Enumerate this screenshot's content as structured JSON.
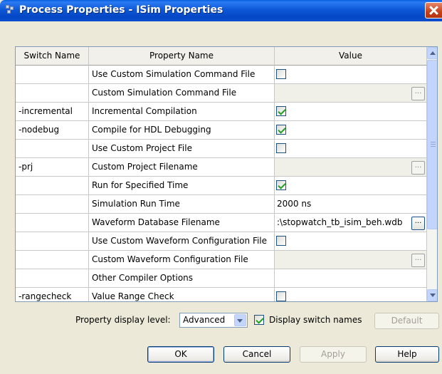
{
  "window": {
    "title": "Process Properties - ISim Properties"
  },
  "table": {
    "headers": [
      "Switch Name",
      "Property Name",
      "Value"
    ],
    "rows": [
      {
        "switch": "",
        "property": "Use Custom Simulation Command File",
        "type": "checkbox",
        "checked": false
      },
      {
        "switch": "",
        "property": "Custom Simulation Command File",
        "type": "file",
        "value": "",
        "disabled": true
      },
      {
        "switch": "-incremental",
        "property": "Incremental Compilation",
        "type": "checkbox",
        "checked": true
      },
      {
        "switch": "-nodebug",
        "property": "Compile for HDL Debugging",
        "type": "checkbox",
        "checked": true
      },
      {
        "switch": "",
        "property": "Use Custom Project File",
        "type": "checkbox",
        "checked": false
      },
      {
        "switch": "-prj",
        "property": "Custom Project Filename",
        "type": "file",
        "value": "",
        "disabled": true
      },
      {
        "switch": "",
        "property": "Run for Specified Time",
        "type": "checkbox",
        "checked": true
      },
      {
        "switch": "",
        "property": "Simulation Run Time",
        "type": "text",
        "value": "2000 ns"
      },
      {
        "switch": "",
        "property": "Waveform Database Filename",
        "type": "file",
        "value": ":\\stopwatch_tb_isim_beh.wdb",
        "disabled": false
      },
      {
        "switch": "",
        "property": "Use Custom Waveform Configuration File",
        "type": "checkbox",
        "checked": false
      },
      {
        "switch": "",
        "property": "Custom Waveform Configuration File",
        "type": "file",
        "value": "",
        "disabled": true
      },
      {
        "switch": "",
        "property": "Other Compiler Options",
        "type": "text",
        "value": ""
      },
      {
        "switch": "-rangecheck",
        "property": "Value Range Check",
        "type": "checkbox",
        "checked": false
      }
    ],
    "browse_label": "..."
  },
  "display_level": {
    "label": "Property display level:",
    "selected": "Advanced",
    "show_switch_label": "Display switch names",
    "show_switch_checked": true,
    "default_button": "Default"
  },
  "buttons": {
    "ok": "OK",
    "cancel": "Cancel",
    "apply": "Apply",
    "help": "Help"
  },
  "colors": {
    "titlebar": "#0a58d8",
    "check": "#21a121",
    "dialog_bg": "#ece9d8"
  }
}
